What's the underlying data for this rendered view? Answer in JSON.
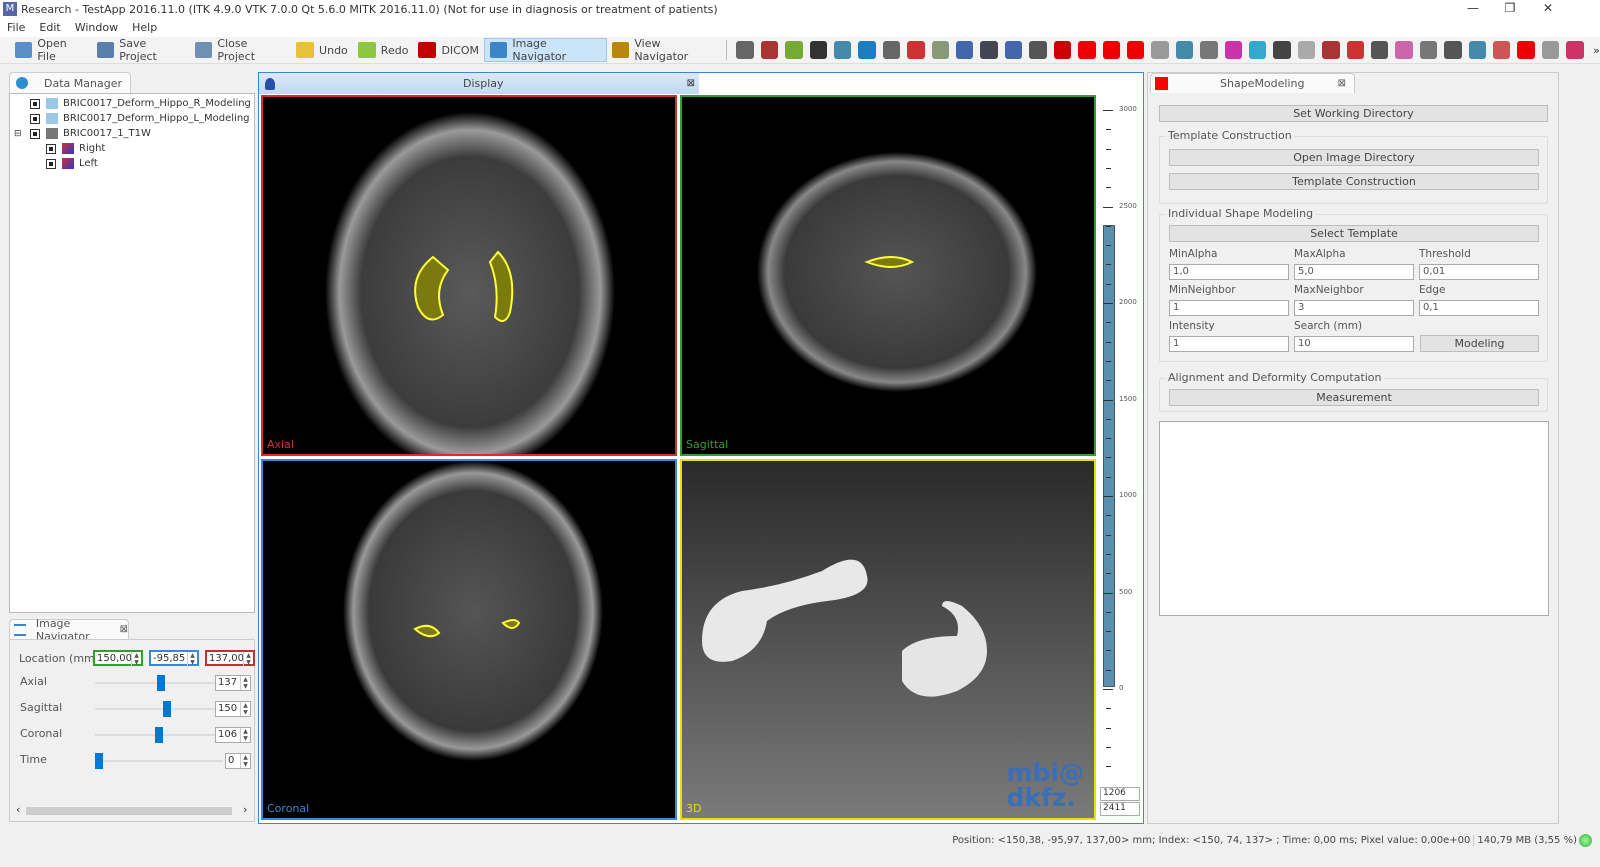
{
  "window": {
    "title": "Research - TestApp 2016.11.0 (ITK 4.9.0  VTK 7.0.0 Qt 5.6.0 MITK 2016.11.0) (Not for use in diagnosis or treatment of patients)",
    "minimize": "—",
    "restore": "❐",
    "close": "✕"
  },
  "menu": [
    "File",
    "Edit",
    "Window",
    "Help"
  ],
  "toolbar": {
    "buttons": [
      {
        "label": "Open File",
        "icon": "folder-icon",
        "color": "#5b8fc9"
      },
      {
        "label": "Save Project",
        "icon": "save-icon",
        "color": "#5a7fa8"
      },
      {
        "label": "Close Project",
        "icon": "close-project-icon",
        "color": "#6f8fb5"
      },
      {
        "label": "Undo",
        "icon": "undo-icon",
        "color": "#e8c13a"
      },
      {
        "label": "Redo",
        "icon": "redo-icon",
        "color": "#8dc63f"
      },
      {
        "label": "DICOM",
        "icon": "dicom-icon",
        "color": "#c00000"
      },
      {
        "label": "Image Navigator",
        "icon": "image-navigator-icon",
        "color": "#3a86c8",
        "active": true
      },
      {
        "label": "View Navigator",
        "icon": "view-navigator-icon",
        "color": "#b8860b"
      }
    ],
    "plugin_icon_colors": [
      "#666",
      "#a33",
      "#7a3",
      "#333",
      "#48a",
      "#1a7fc2",
      "#666",
      "#c33",
      "#897",
      "#46a",
      "#445",
      "#46a",
      "#555",
      "#c00",
      "#e00",
      "#e00",
      "#e00",
      "#999",
      "#48a",
      "#777",
      "#c3a",
      "#3ac",
      "#444",
      "#aaa",
      "#a33",
      "#c33",
      "#555",
      "#c6a",
      "#777",
      "#555",
      "#48a",
      "#c55",
      "#e00",
      "#999",
      "#c36"
    ],
    "overflow": "»"
  },
  "data_manager": {
    "tab": "Data Manager",
    "items": [
      {
        "label": "BRIC0017_Deform_Hippo_R_Modeling",
        "level": 1
      },
      {
        "label": "BRIC0017_Deform_Hippo_L_Modeling",
        "level": 1
      },
      {
        "label": "BRIC0017_1_T1W",
        "level": 1,
        "expanded": true
      },
      {
        "label": "Right",
        "level": 2
      },
      {
        "label": "Left",
        "level": 2
      }
    ],
    "expander": "⊟"
  },
  "navigator": {
    "tab": "Image Navigator",
    "close": "⊠",
    "location_label": "Location (mm)",
    "location": [
      {
        "value": "150,00",
        "color": "#2ea02e"
      },
      {
        "value": "-95,85",
        "color": "#3a86d8"
      },
      {
        "value": "137,00",
        "color": "#c03030"
      }
    ],
    "sliders": [
      {
        "label": "Axial",
        "value": "137",
        "fraction": 0.52
      },
      {
        "label": "Sagittal",
        "value": "150",
        "fraction": 0.57
      },
      {
        "label": "Coronal",
        "value": "106",
        "fraction": 0.5
      },
      {
        "label": "Time",
        "value": "0",
        "fraction": 0.0
      }
    ],
    "hscroll_left": "‹",
    "hscroll_right": "›"
  },
  "display": {
    "tab": "Display",
    "close": "⊠",
    "views": [
      {
        "label": "Axial",
        "color": "#d03030"
      },
      {
        "label": "Sagittal",
        "color": "#2ea02e"
      },
      {
        "label": "Coronal",
        "color": "#3a86d8"
      },
      {
        "label": "3D",
        "color": "#e8e000"
      }
    ],
    "watermark": [
      "mbi@",
      "dkfz."
    ],
    "scale_labels": [
      "3000",
      "2500",
      "2000",
      "1500",
      "1000",
      "500",
      "0"
    ],
    "level_window": [
      "1206",
      "2411"
    ]
  },
  "shape_modeling": {
    "tab": "ShapeModeling",
    "close": "⊠",
    "set_working_directory": "Set Working Directory",
    "template_construction": {
      "title": "Template Construction",
      "open_image_directory": "Open Image Directory",
      "template_construction": "Template Construction"
    },
    "individual": {
      "title": "Individual Shape Modeling",
      "select_template": "Select Template",
      "fields": [
        {
          "label": "MinAlpha",
          "value": "1,0"
        },
        {
          "label": "MaxAlpha",
          "value": "5,0"
        },
        {
          "label": "Threshold",
          "value": "0,01"
        },
        {
          "label": "MinNeighbor",
          "value": "1"
        },
        {
          "label": "MaxNeighbor",
          "value": "3"
        },
        {
          "label": "Edge",
          "value": "0,1"
        },
        {
          "label": "Intensity",
          "value": "1"
        },
        {
          "label": "Search (mm)",
          "value": "10"
        }
      ],
      "modeling": "Modeling"
    },
    "alignment": {
      "title": "Alignment and Deformity Computation",
      "measurement": "Measurement"
    }
  },
  "status": {
    "text": "Position: <150,38, -95,97, 137,00> mm; Index: <150, 74, 137> ; Time: 0,00 ms; Pixel value: 0,00e+00",
    "memory": "140,79 MB (3,55 %)"
  }
}
